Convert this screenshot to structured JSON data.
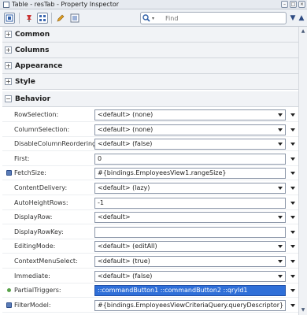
{
  "window": {
    "title": "Table - resTab - Property Inspector"
  },
  "search": {
    "placeholder": "Find"
  },
  "sections": {
    "common": "Common",
    "columns": "Columns",
    "appearance": "Appearance",
    "style": "Style",
    "behavior": "Behavior"
  },
  "properties": [
    {
      "name": "RowSelection:",
      "value": "<default> (none)",
      "type": "select"
    },
    {
      "name": "ColumnSelection:",
      "value": "<default> (none)",
      "type": "select"
    },
    {
      "name": "DisableColumnReordering:",
      "value": "<default> (false)",
      "type": "select"
    },
    {
      "name": "First:",
      "value": "0",
      "type": "text"
    },
    {
      "name": "FetchSize:",
      "value": "#{bindings.EmployeesView1.rangeSize}",
      "type": "text",
      "icon": "binding-icon"
    },
    {
      "name": "ContentDelivery:",
      "value": "<default> (lazy)",
      "type": "select"
    },
    {
      "name": "AutoHeightRows:",
      "value": "-1",
      "type": "text"
    },
    {
      "name": "DisplayRow:",
      "value": "<default>",
      "type": "select"
    },
    {
      "name": "DisplayRowKey:",
      "value": "",
      "type": "text"
    },
    {
      "name": "EditingMode:",
      "value": "<default> (editAll)",
      "type": "select"
    },
    {
      "name": "ContextMenuSelect:",
      "value": "<default> (true)",
      "type": "select"
    },
    {
      "name": "Immediate:",
      "value": "<default> (false)",
      "type": "select"
    },
    {
      "name": "PartialTriggers:",
      "value": "::commandButton1 ::commandButton2 ::qryId1",
      "type": "text",
      "icon": "required-dot-icon",
      "highlight": true
    },
    {
      "name": "FilterModel:",
      "value": "#{bindings.EmployeesViewCriteriaQuery.queryDescriptor}",
      "type": "text",
      "icon": "binding-icon"
    }
  ]
}
